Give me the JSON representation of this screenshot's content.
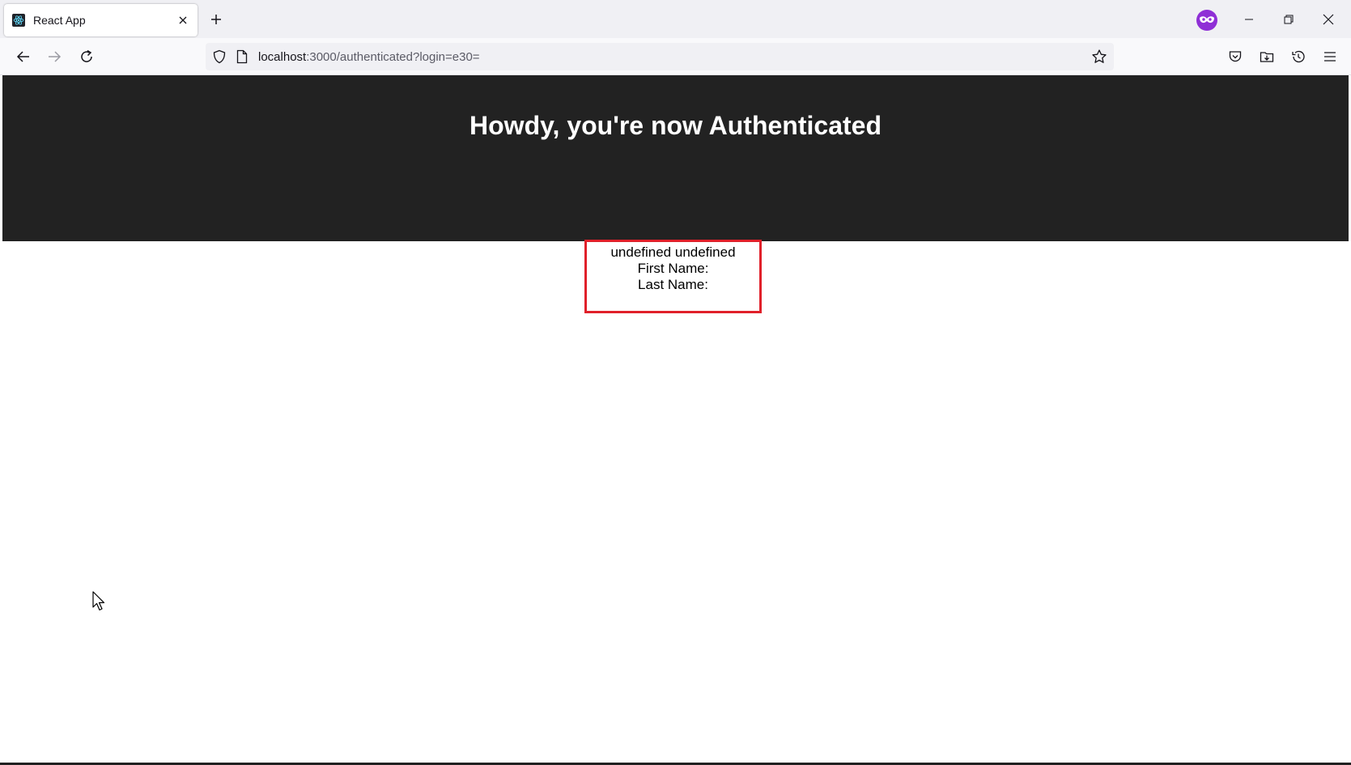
{
  "browser": {
    "tab": {
      "title": "React App",
      "favicon": "react-icon"
    },
    "new_tab_icon": "plus-icon",
    "private_icon": "private-browsing-icon",
    "window_controls": [
      "minimize-icon",
      "restore-icon",
      "close-icon"
    ],
    "nav": {
      "back_icon": "back-arrow-icon",
      "forward_icon": "forward-arrow-icon",
      "reload_icon": "reload-icon"
    },
    "address": {
      "host": "localhost",
      "rest": ":3000/authenticated?login=e30="
    },
    "toolbar_icons": [
      "pocket-icon",
      "downloads-folder-icon",
      "history-icon",
      "menu-icon"
    ]
  },
  "page": {
    "heading": "Howdy, you're now Authenticated",
    "user_info": {
      "full_name": "undefined undefined",
      "first_name_label": "First Name:",
      "last_name_label": "Last Name:"
    }
  },
  "colors": {
    "header_bg": "#222222",
    "heading_text": "#ffffff",
    "highlight_border": "#e0202a",
    "private_purple": "#8f2fd6"
  }
}
